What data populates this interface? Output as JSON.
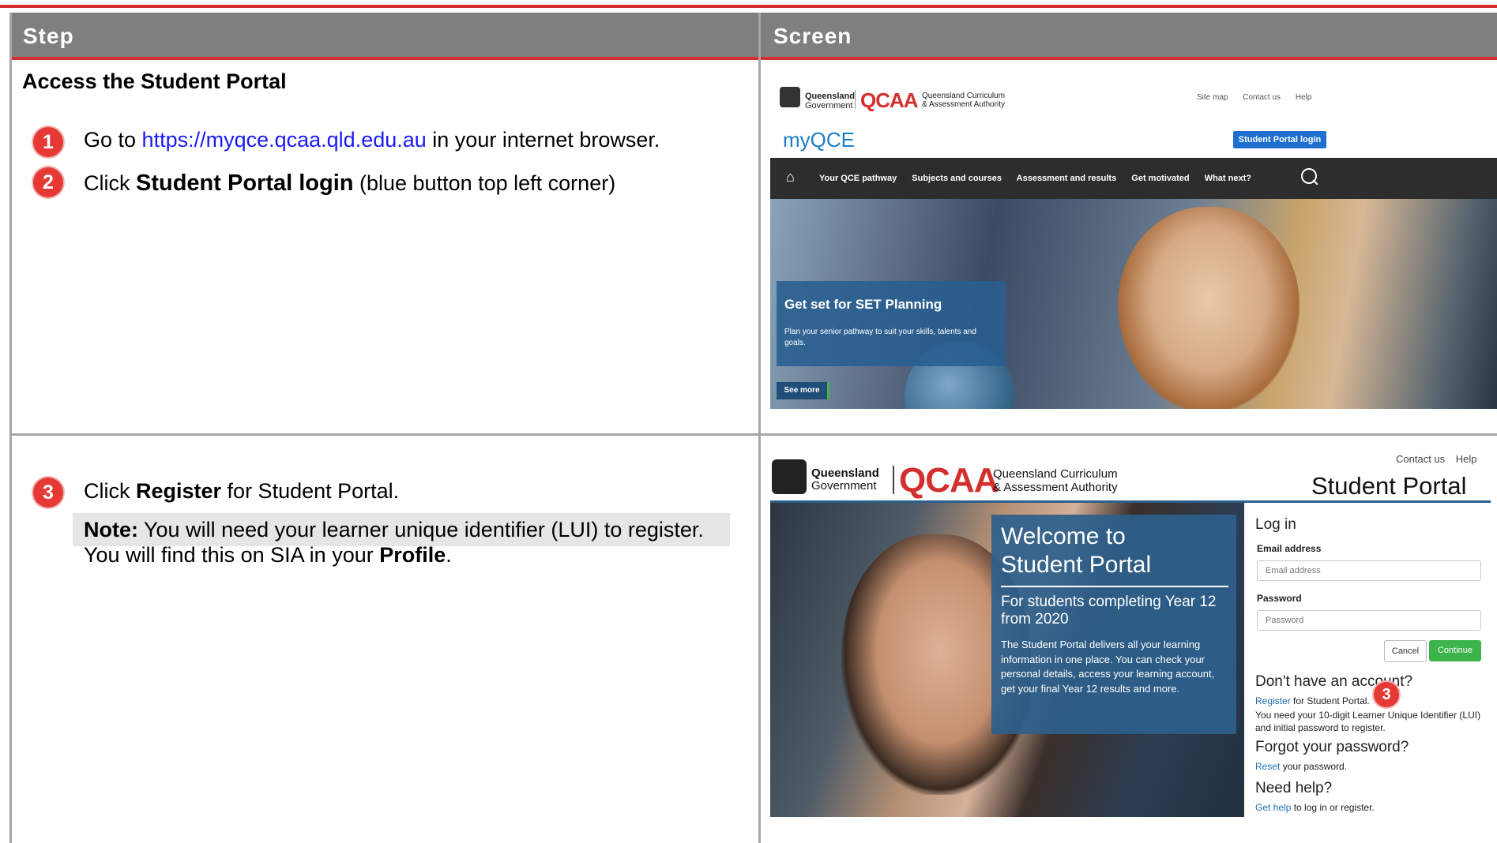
{
  "table": {
    "col_step": "Step",
    "col_screen": "Screen"
  },
  "row1": {
    "title": "Access the Student Portal",
    "step1_num": "1",
    "step1_pre": "Go to ",
    "step1_link": "https://myqce.qcaa.qld.edu.au",
    "step1_post": " in your internet browser.",
    "step2_num": "2",
    "step2_pre": "Click ",
    "step2_bold": "Student Portal login",
    "step2_post": "  (blue button top left corner)"
  },
  "row2": {
    "step3_num": "3",
    "step3_pre": "Click ",
    "step3_bold": "Register",
    "step3_post": " for Student Portal.",
    "note_label": "Note:",
    "note_text": " You will need your learner unique identifier (LUI) to register.",
    "note_line2_pre": "You will find this on SIA in your ",
    "note_line2_bold": "Profile",
    "note_line2_post": "."
  },
  "shot1": {
    "gov_line1": "Queensland",
    "gov_line2": "Government",
    "qcaa": "QCAA",
    "qcaa_sub1": "Queensland Curriculum",
    "qcaa_sub2": "& Assessment Authority",
    "top_links": [
      "Site map",
      "Contact us",
      "Help"
    ],
    "brand": "myQCE",
    "login_button": "Student Portal login",
    "nav": [
      "Your QCE pathway",
      "Subjects and courses",
      "Assessment and results",
      "Get motivated",
      "What next?"
    ],
    "promo_title": "Get set for SET Planning",
    "promo_text": "Plan your senior pathway to suit your skills, talents and goals.",
    "see_more": "See more"
  },
  "shot2": {
    "top_links": [
      "Contact us",
      "Help"
    ],
    "gov_line1": "Queensland",
    "gov_line2": "Government",
    "qcaa": "QCAA",
    "qcaa_sub1": "Queensland Curriculum",
    "qcaa_sub2": "& Assessment Authority",
    "portal_title": "Student Portal",
    "welcome_title1": "Welcome to",
    "welcome_title2": "Student Portal",
    "welcome_sub": "For students completing Year 12 from 2020",
    "welcome_body": "The Student Portal delivers all your learning information in one place. You can check your personal details, access your learning account, get your final Year 12 results and more.",
    "login_heading": "Log in",
    "email_label": "Email address",
    "email_placeholder": "Email address",
    "password_label": "Password",
    "password_placeholder": "Password",
    "cancel": "Cancel",
    "continue": "Continue",
    "no_account": "Don't have an account?",
    "register_link": "Register",
    "register_rest": " for Student Portal.",
    "lui_text": "You need your 10-digit Learner Unique Identifier (LUI) and initial password to register.",
    "forgot": "Forgot your password?",
    "reset_link": "Reset",
    "reset_rest": " your password.",
    "need_help": "Need help?",
    "help_link": "Get help",
    "help_rest": " to log in or register.",
    "callout_num": "3"
  },
  "colors": {
    "accent_red": "#d32f2f",
    "header_gray": "#7f7f7f",
    "link_blue": "#1a1aff"
  }
}
